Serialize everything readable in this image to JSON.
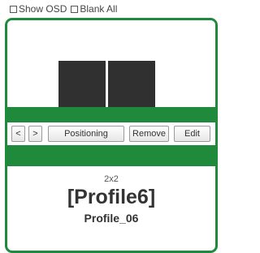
{
  "options": {
    "show_osd_label": "Show OSD",
    "blank_all_label": "Blank All"
  },
  "profile_card": {
    "accent_color": "#1f8a3b",
    "tile_color": "#303030",
    "buttons": {
      "prev_label": "<",
      "next_label": ">",
      "positioning_label": "Positioning",
      "remove_label": "Remove",
      "edit_label": "Edit"
    },
    "layout_label": "2x2",
    "profile_title": "[Profile6]",
    "profile_subtitle": "Profile_06"
  }
}
